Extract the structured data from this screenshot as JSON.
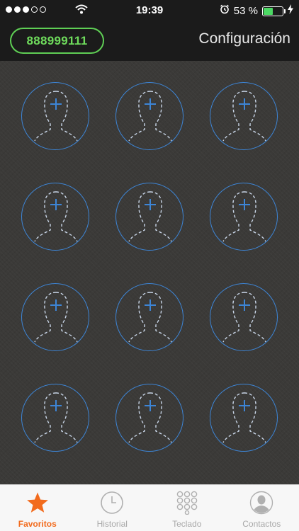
{
  "status_bar": {
    "time": "19:39",
    "battery_percent": "53 %",
    "battery_level": 0.53,
    "signal_bars_filled": 3,
    "signal_bars_total": 5,
    "icons": [
      "wifi-icon",
      "alarm-icon",
      "battery-icon",
      "charging-bolt-icon"
    ]
  },
  "header": {
    "phone_number": "888999111",
    "settings_label": "Configuración"
  },
  "favorites": {
    "slot_icon": "add-contact-silhouette-icon",
    "slot_count": 12,
    "accent_color": "#3d85d6"
  },
  "tabs": [
    {
      "label": "Favoritos",
      "icon": "star-icon",
      "active": true
    },
    {
      "label": "Historial",
      "icon": "clock-icon",
      "active": false
    },
    {
      "label": "Teclado",
      "icon": "keypad-icon",
      "active": false
    },
    {
      "label": "Contactos",
      "icon": "contact-icon",
      "active": false
    }
  ],
  "colors": {
    "active_tab": "#f26b1d",
    "inactive_tab": "#a8a8a8",
    "number_pill": "#5fcf55"
  }
}
